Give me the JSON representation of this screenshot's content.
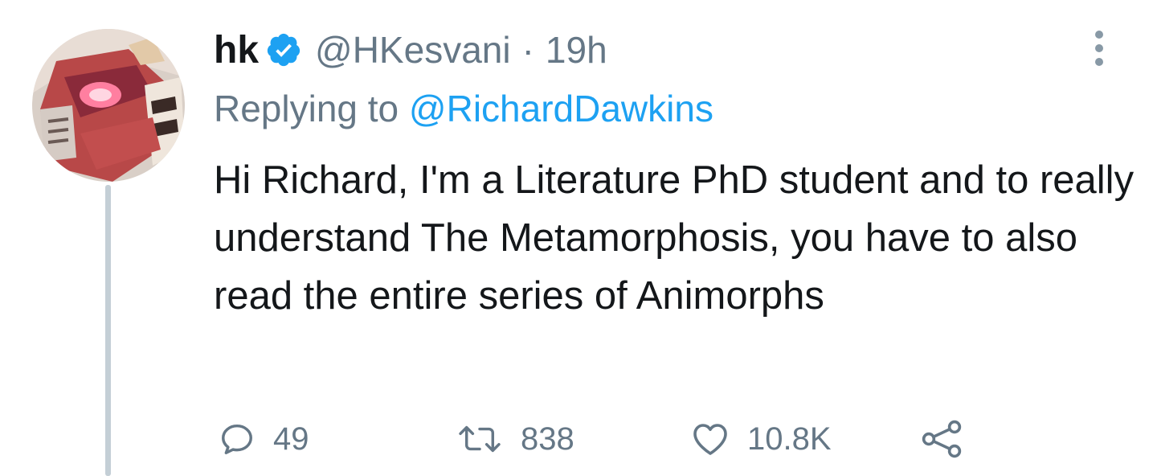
{
  "tweet": {
    "display_name": "hk",
    "handle": "@HKesvani",
    "separator": "·",
    "time": "19h",
    "verified": true,
    "replying_prefix": "Replying to ",
    "replying_to": "@RichardDawkins",
    "text": "Hi Richard, I'm a Literature PhD student and to really understand The Metamorphosis, you have to also read the entire series of Animorphs",
    "counts": {
      "replies": "49",
      "retweets": "838",
      "likes": "10.8K"
    }
  },
  "colors": {
    "text": "#14171a",
    "secondary": "#657786",
    "accent": "#1da1f2",
    "thread_line": "#c4cfd6"
  },
  "icons": {
    "verified": "verified-badge-icon",
    "more": "more-vertical-icon",
    "reply": "reply-icon",
    "retweet": "retweet-icon",
    "like": "heart-icon",
    "share": "share-icon"
  }
}
